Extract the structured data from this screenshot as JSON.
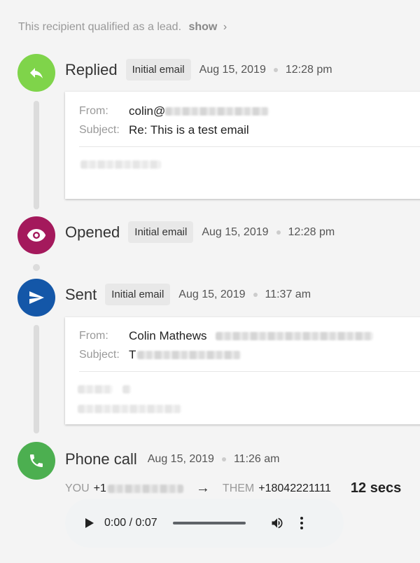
{
  "lead_note": {
    "text": "This recipient qualified as a lead.",
    "show_label": "show",
    "chevron": "›"
  },
  "events": {
    "replied": {
      "icon": "reply-icon",
      "color": "#7fd44a",
      "title": "Replied",
      "badge": "Initial email",
      "date": "Aug 15, 2019",
      "time": "12:28 pm",
      "from_label": "From:",
      "from_value": "colin@",
      "subject_label": "Subject:",
      "subject_value": "Re: This is a test email"
    },
    "opened": {
      "icon": "eye-icon",
      "color": "#a4195c",
      "title": "Opened",
      "badge": "Initial email",
      "date": "Aug 15, 2019",
      "time": "12:28 pm"
    },
    "sent": {
      "icon": "send-icon",
      "color": "#1457a8",
      "title": "Sent",
      "badge": "Initial email",
      "date": "Aug 15, 2019",
      "time": "11:37 am",
      "from_label": "From:",
      "from_value": "Colin Mathews",
      "subject_label": "Subject:",
      "subject_value": "T"
    },
    "phone": {
      "icon": "phone-icon",
      "color": "#4caf50",
      "title": "Phone call",
      "date": "Aug 15, 2019",
      "time": "11:26 am",
      "you_label": "YOU",
      "you_number": "+1",
      "arrow": "→",
      "them_label": "THEM",
      "them_number": "+18042221111",
      "duration": "12 secs"
    }
  },
  "player": {
    "time": "0:00 / 0:07",
    "progress": 0,
    "play_icon": "play-icon",
    "volume_icon": "volume-icon",
    "menu_icon": "more-vert-icon"
  }
}
